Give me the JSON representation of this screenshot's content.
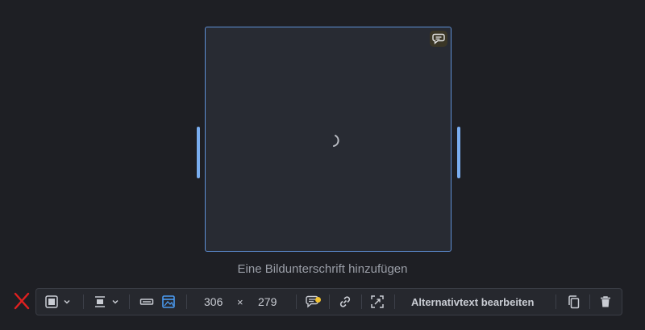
{
  "image": {
    "caption_placeholder": "Eine Bildunterschrift hinzufügen"
  },
  "toolbar": {
    "width_value": "306",
    "times_symbol": "×",
    "height_value": "279",
    "alt_text_label": "Alternativtext bearbeiten"
  },
  "icons": {
    "close": "close-icon",
    "caption": "caption-icon",
    "spinner": "loading-spinner-icon",
    "block_style": "block-style-icon",
    "align": "align-icon",
    "full_width": "full-width-icon",
    "image_wrap": "image-wrap-icon",
    "link": "link-icon",
    "crop": "crop-icon",
    "duplicate": "duplicate-icon",
    "delete": "trash-icon"
  },
  "colors": {
    "selection_border": "#5e8fd6",
    "active_icon": "#4a9af0",
    "close_red": "#e02020",
    "notification_dot": "#f2c230"
  }
}
